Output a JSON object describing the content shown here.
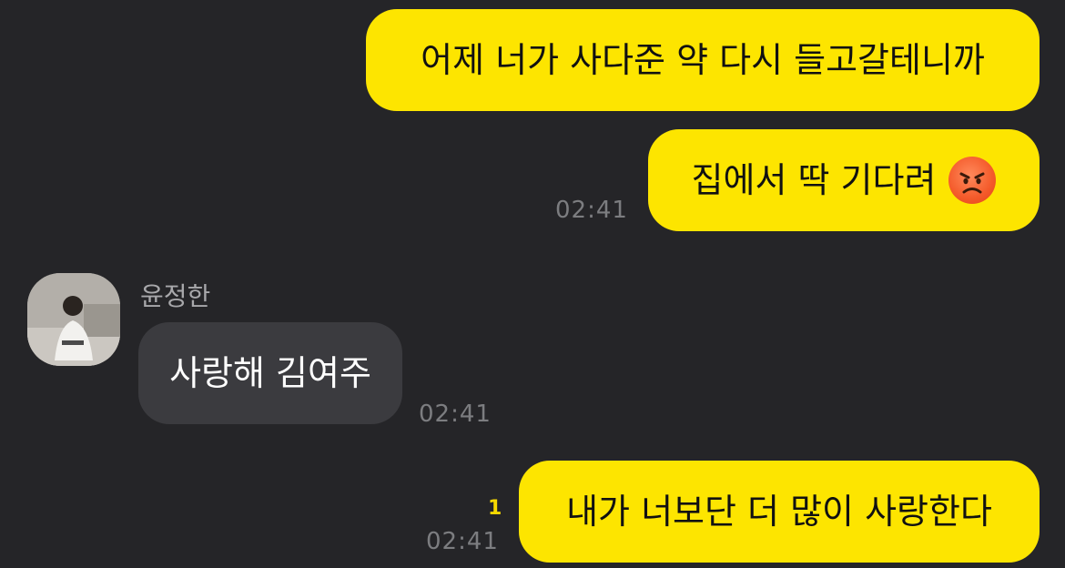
{
  "messages": [
    {
      "side": "me",
      "text": "어제 너가 사다준 약 다시 들고갈테니까"
    },
    {
      "side": "me",
      "text": "집에서 딱 기다려",
      "emoji": "angry-face-icon",
      "time": "02:41"
    },
    {
      "side": "them",
      "sender": "윤정한",
      "text": "사랑해 김여주",
      "time": "02:41"
    },
    {
      "side": "me",
      "text": "내가 너보단 더 많이 사랑한다",
      "time": "02:41",
      "unread": "1"
    }
  ],
  "colors": {
    "background": "#252528",
    "my_bubble": "#fde500",
    "their_bubble": "#3b3b3f",
    "time_text": "#7c7d80",
    "unread_count": "#f7d900"
  }
}
